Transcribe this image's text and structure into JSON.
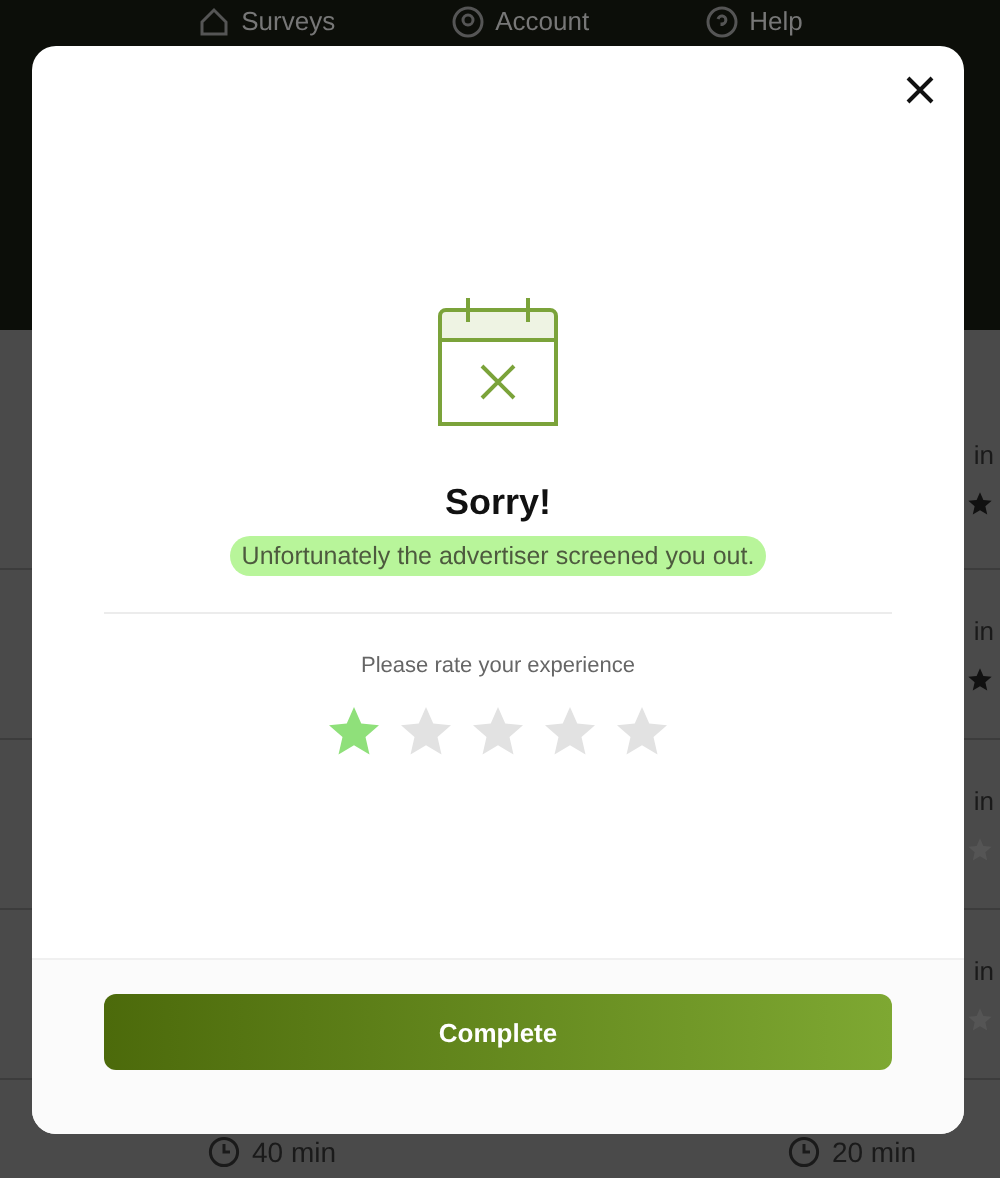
{
  "nav": [
    {
      "label": "Surveys",
      "kind": "home"
    },
    {
      "label": "Account",
      "kind": "account"
    },
    {
      "label": "Help",
      "kind": "help"
    }
  ],
  "background_rows": [
    {
      "duration": "in",
      "starred": true
    },
    {
      "duration": "in",
      "starred": true
    },
    {
      "duration": "in",
      "starred": false
    },
    {
      "duration": "in",
      "starred": false
    }
  ],
  "bottom_row": {
    "left": "40 min",
    "right": "20 min"
  },
  "dialog": {
    "title": "Sorry!",
    "message": "Unfortunately the advertiser screened you out.",
    "message_highlighted": true,
    "rating_prompt": "Please rate your experience",
    "stars": 1,
    "button": "Complete"
  }
}
